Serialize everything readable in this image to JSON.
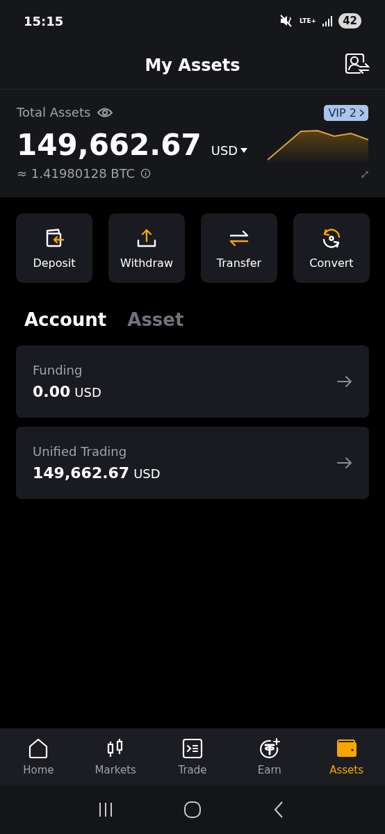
{
  "status_bar": {
    "time": "15:15",
    "network": "LTE+",
    "battery": "42"
  },
  "header": {
    "title": "My Assets"
  },
  "total": {
    "label": "Total Assets",
    "vip": "VIP 2",
    "amount": "149,662.67",
    "currency": "USD",
    "btc": "≈ 1.41980128 BTC"
  },
  "actions": [
    {
      "kind": "deposit",
      "label": "Deposit"
    },
    {
      "kind": "withdraw",
      "label": "Withdraw"
    },
    {
      "kind": "transfer",
      "label": "Transfer"
    },
    {
      "kind": "convert",
      "label": "Convert"
    }
  ],
  "tabs": [
    {
      "label": "Account",
      "selected": true
    },
    {
      "label": "Asset",
      "selected": false
    }
  ],
  "accounts": [
    {
      "name": "Funding",
      "amount": "0.00",
      "currency": "USD"
    },
    {
      "name": "Unified Trading",
      "amount": "149,662.67",
      "currency": "USD"
    }
  ],
  "bottom_nav": [
    {
      "kind": "home",
      "label": "Home",
      "selected": false
    },
    {
      "kind": "markets",
      "label": "Markets",
      "selected": false
    },
    {
      "kind": "trade",
      "label": "Trade",
      "selected": false
    },
    {
      "kind": "earn",
      "label": "Earn",
      "selected": false
    },
    {
      "kind": "assets",
      "label": "Assets",
      "selected": true
    }
  ]
}
